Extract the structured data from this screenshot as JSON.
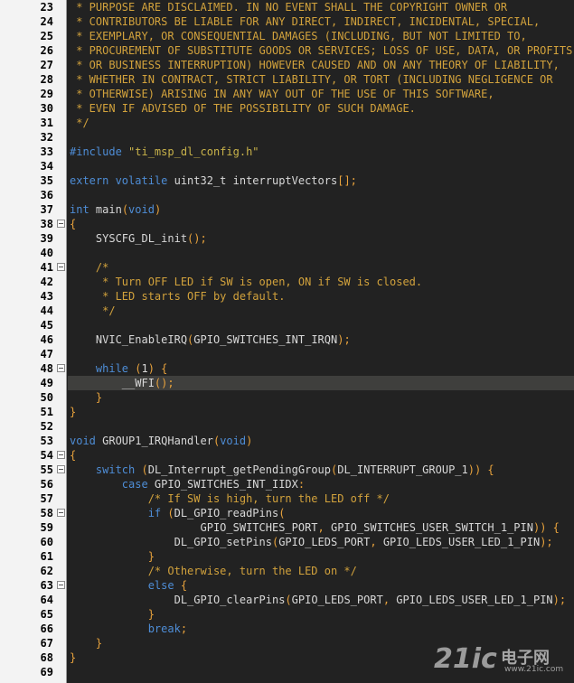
{
  "editor": {
    "current_line": 49,
    "lines": [
      {
        "n": "23",
        "fold": false,
        "tokens": [
          [
            " * PURPOSE ARE DISCLAIMED. IN NO EVENT SHALL THE COPYRIGHT OWNER OR",
            "comment"
          ]
        ]
      },
      {
        "n": "24",
        "fold": false,
        "tokens": [
          [
            " * CONTRIBUTORS BE LIABLE FOR ANY DIRECT, INDIRECT, INCIDENTAL, SPECIAL,",
            "comment"
          ]
        ]
      },
      {
        "n": "25",
        "fold": false,
        "tokens": [
          [
            " * EXEMPLARY, OR CONSEQUENTIAL DAMAGES (INCLUDING, BUT NOT LIMITED TO,",
            "comment"
          ]
        ]
      },
      {
        "n": "26",
        "fold": false,
        "tokens": [
          [
            " * PROCUREMENT OF SUBSTITUTE GOODS OR SERVICES; LOSS OF USE, DATA, OR PROFITS;",
            "comment"
          ]
        ]
      },
      {
        "n": "27",
        "fold": false,
        "tokens": [
          [
            " * OR BUSINESS INTERRUPTION) HOWEVER CAUSED AND ON ANY THEORY OF LIABILITY,",
            "comment"
          ]
        ]
      },
      {
        "n": "28",
        "fold": false,
        "tokens": [
          [
            " * WHETHER IN CONTRACT, STRICT LIABILITY, OR TORT (INCLUDING NEGLIGENCE OR",
            "comment"
          ]
        ]
      },
      {
        "n": "29",
        "fold": false,
        "tokens": [
          [
            " * OTHERWISE) ARISING IN ANY WAY OUT OF THE USE OF THIS SOFTWARE,",
            "comment"
          ]
        ]
      },
      {
        "n": "30",
        "fold": false,
        "tokens": [
          [
            " * EVEN IF ADVISED OF THE POSSIBILITY OF SUCH DAMAGE.",
            "comment"
          ]
        ]
      },
      {
        "n": "31",
        "fold": false,
        "tokens": [
          [
            " */",
            "comment"
          ]
        ]
      },
      {
        "n": "32",
        "fold": false,
        "tokens": []
      },
      {
        "n": "33",
        "fold": false,
        "tokens": [
          [
            "#include ",
            "pre"
          ],
          [
            "\"ti_msp_dl_config.h\"",
            "str"
          ]
        ]
      },
      {
        "n": "34",
        "fold": false,
        "tokens": []
      },
      {
        "n": "35",
        "fold": false,
        "tokens": [
          [
            "extern volatile ",
            "kw"
          ],
          [
            "uint32_t interruptVectors",
            "id"
          ],
          [
            "[];",
            "op"
          ]
        ]
      },
      {
        "n": "36",
        "fold": false,
        "tokens": []
      },
      {
        "n": "37",
        "fold": false,
        "tokens": [
          [
            "int ",
            "kw"
          ],
          [
            "main",
            "id"
          ],
          [
            "(",
            "op"
          ],
          [
            "void",
            "kw"
          ],
          [
            ")",
            "op"
          ]
        ]
      },
      {
        "n": "38",
        "fold": true,
        "tokens": [
          [
            "{",
            "op"
          ]
        ]
      },
      {
        "n": "39",
        "fold": false,
        "tokens": [
          [
            "    SYSCFG_DL_init",
            "id"
          ],
          [
            "();",
            "op"
          ]
        ]
      },
      {
        "n": "40",
        "fold": false,
        "tokens": []
      },
      {
        "n": "41",
        "fold": true,
        "tokens": [
          [
            "    /*",
            "comment"
          ]
        ]
      },
      {
        "n": "42",
        "fold": false,
        "tokens": [
          [
            "     * Turn OFF LED if SW is open, ON if SW is closed.",
            "comment"
          ]
        ]
      },
      {
        "n": "43",
        "fold": false,
        "tokens": [
          [
            "     * LED starts OFF by default.",
            "comment"
          ]
        ]
      },
      {
        "n": "44",
        "fold": false,
        "tokens": [
          [
            "     */",
            "comment"
          ]
        ]
      },
      {
        "n": "45",
        "fold": false,
        "tokens": []
      },
      {
        "n": "46",
        "fold": false,
        "tokens": [
          [
            "    NVIC_EnableIRQ",
            "id"
          ],
          [
            "(",
            "op"
          ],
          [
            "GPIO_SWITCHES_INT_IRQN",
            "id"
          ],
          [
            ");",
            "op"
          ]
        ]
      },
      {
        "n": "47",
        "fold": false,
        "tokens": []
      },
      {
        "n": "48",
        "fold": true,
        "tokens": [
          [
            "    while ",
            "kw"
          ],
          [
            "(",
            "op"
          ],
          [
            "1",
            "id"
          ],
          [
            ") {",
            "op"
          ]
        ]
      },
      {
        "n": "49",
        "fold": false,
        "tokens": [
          [
            "        __WFI",
            "id"
          ],
          [
            "();",
            "op"
          ]
        ]
      },
      {
        "n": "50",
        "fold": false,
        "tokens": [
          [
            "    }",
            "op"
          ]
        ]
      },
      {
        "n": "51",
        "fold": false,
        "tokens": [
          [
            "}",
            "op"
          ]
        ]
      },
      {
        "n": "52",
        "fold": false,
        "tokens": []
      },
      {
        "n": "53",
        "fold": false,
        "tokens": [
          [
            "void ",
            "kw"
          ],
          [
            "GROUP1_IRQHandler",
            "id"
          ],
          [
            "(",
            "op"
          ],
          [
            "void",
            "kw"
          ],
          [
            ")",
            "op"
          ]
        ]
      },
      {
        "n": "54",
        "fold": true,
        "tokens": [
          [
            "{",
            "op"
          ]
        ]
      },
      {
        "n": "55",
        "fold": true,
        "tokens": [
          [
            "    switch ",
            "kw"
          ],
          [
            "(",
            "op"
          ],
          [
            "DL_Interrupt_getPendingGroup",
            "id"
          ],
          [
            "(",
            "op"
          ],
          [
            "DL_INTERRUPT_GROUP_1",
            "id"
          ],
          [
            ")) {",
            "op"
          ]
        ]
      },
      {
        "n": "56",
        "fold": false,
        "tokens": [
          [
            "        case ",
            "kw"
          ],
          [
            "GPIO_SWITCHES_INT_IIDX",
            "id"
          ],
          [
            ":",
            "op"
          ]
        ]
      },
      {
        "n": "57",
        "fold": false,
        "tokens": [
          [
            "            /* If SW is high, turn the LED off */",
            "comment"
          ]
        ]
      },
      {
        "n": "58",
        "fold": true,
        "tokens": [
          [
            "            if ",
            "kw"
          ],
          [
            "(",
            "op"
          ],
          [
            "DL_GPIO_readPins",
            "id"
          ],
          [
            "(",
            "op"
          ]
        ]
      },
      {
        "n": "59",
        "fold": false,
        "tokens": [
          [
            "                    GPIO_SWITCHES_PORT",
            "id"
          ],
          [
            ", ",
            "op"
          ],
          [
            "GPIO_SWITCHES_USER_SWITCH_1_PIN",
            "id"
          ],
          [
            ")) {",
            "op"
          ]
        ]
      },
      {
        "n": "60",
        "fold": false,
        "tokens": [
          [
            "                DL_GPIO_setPins",
            "id"
          ],
          [
            "(",
            "op"
          ],
          [
            "GPIO_LEDS_PORT",
            "id"
          ],
          [
            ", ",
            "op"
          ],
          [
            "GPIO_LEDS_USER_LED_1_PIN",
            "id"
          ],
          [
            ");",
            "op"
          ]
        ]
      },
      {
        "n": "61",
        "fold": false,
        "tokens": [
          [
            "            }",
            "op"
          ]
        ]
      },
      {
        "n": "62",
        "fold": false,
        "tokens": [
          [
            "            /* Otherwise, turn the LED on */",
            "comment"
          ]
        ]
      },
      {
        "n": "63",
        "fold": true,
        "tokens": [
          [
            "            else ",
            "kw"
          ],
          [
            "{",
            "op"
          ]
        ]
      },
      {
        "n": "64",
        "fold": false,
        "tokens": [
          [
            "                DL_GPIO_clearPins",
            "id"
          ],
          [
            "(",
            "op"
          ],
          [
            "GPIO_LEDS_PORT",
            "id"
          ],
          [
            ", ",
            "op"
          ],
          [
            "GPIO_LEDS_USER_LED_1_PIN",
            "id"
          ],
          [
            ");",
            "op"
          ]
        ]
      },
      {
        "n": "65",
        "fold": false,
        "tokens": [
          [
            "            }",
            "op"
          ]
        ]
      },
      {
        "n": "66",
        "fold": false,
        "tokens": [
          [
            "            break",
            "kw"
          ],
          [
            ";",
            "op"
          ]
        ]
      },
      {
        "n": "67",
        "fold": false,
        "tokens": [
          [
            "    }",
            "op"
          ]
        ]
      },
      {
        "n": "68",
        "fold": false,
        "tokens": [
          [
            "}",
            "op"
          ]
        ]
      },
      {
        "n": "69",
        "fold": false,
        "tokens": []
      }
    ]
  },
  "watermark": {
    "logo": "21ic",
    "name": "电子网",
    "url": "www.21ic.com"
  },
  "colors": {
    "comment": "#d2a23c",
    "keyword": "#4e8dd6",
    "string": "#c9b34a",
    "operator": "#e8a23c",
    "identifier": "#d8d8d8",
    "background": "#222222",
    "gutter": "#f3f3f3",
    "current_line": "#3f3f3d"
  }
}
